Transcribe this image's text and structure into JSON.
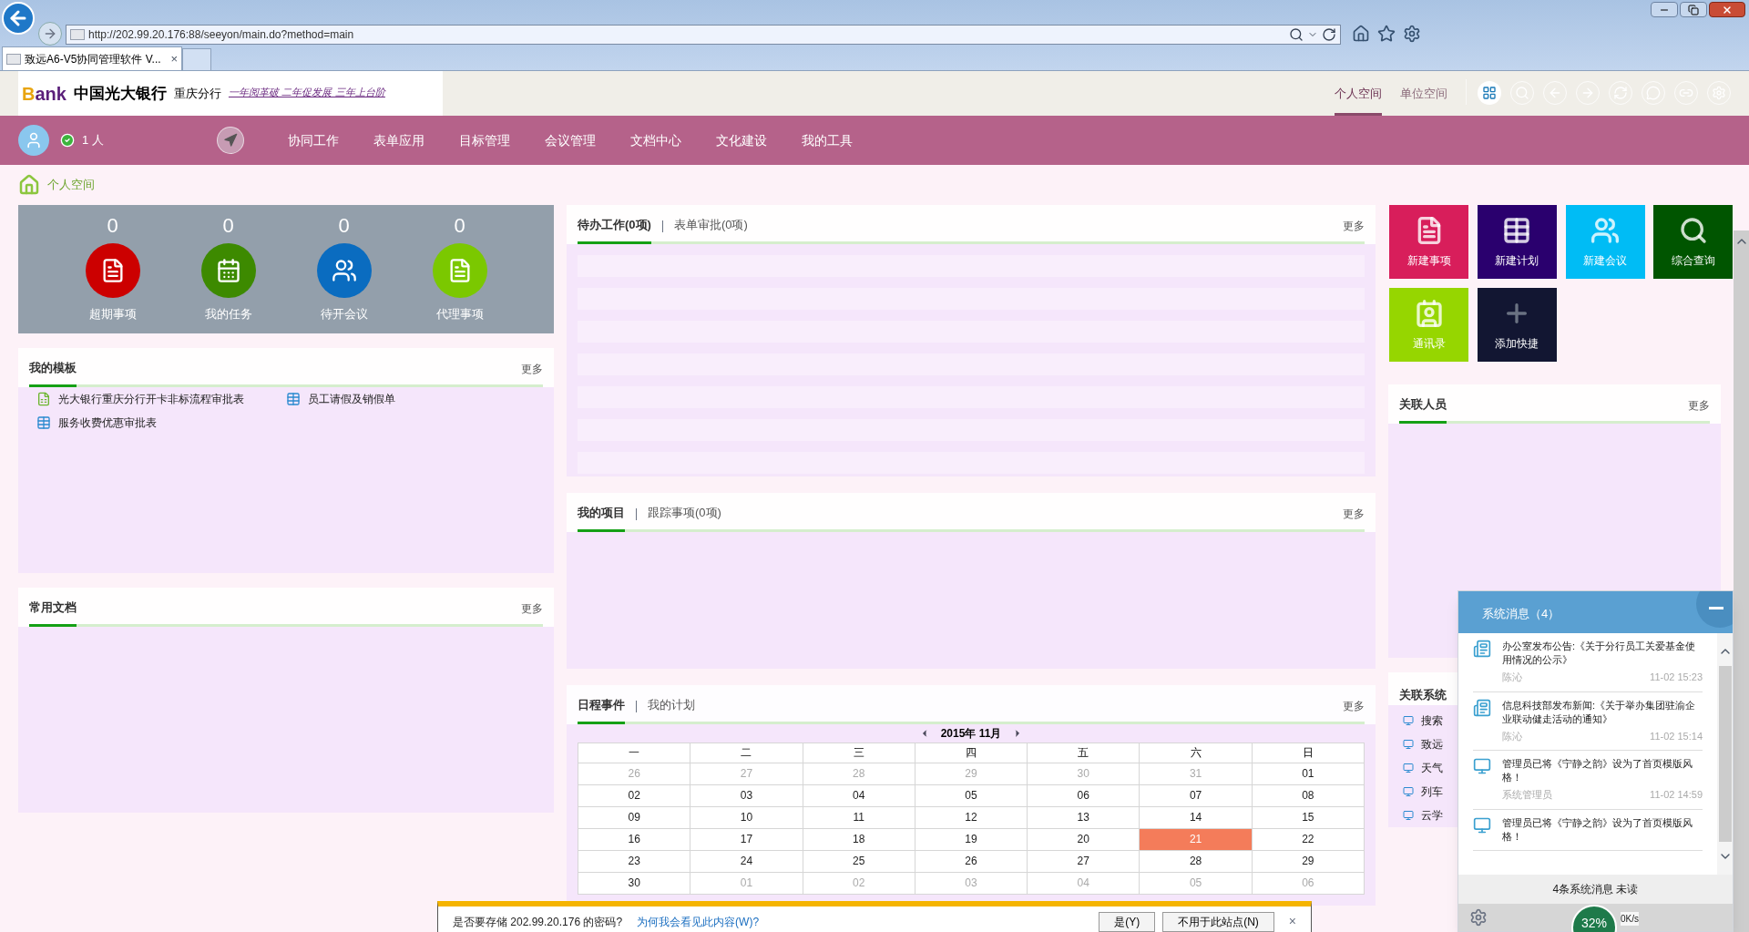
{
  "browser": {
    "address": "http://202.99.20.176:88/seeyon/main.do?method=main",
    "tab": "致远A6-V5协同管理软件 V...",
    "tab_close": "×"
  },
  "header": {
    "bank": "ank",
    "bank_initial": "B",
    "bank_name": "中国光大银行",
    "branch": "重庆分行",
    "slogan": "一年阅革破  二年促发展  三年上台阶",
    "spaces": [
      {
        "label": "个人空间",
        "selected": true
      },
      {
        "label": "单位空间",
        "selected": false
      }
    ]
  },
  "nav": {
    "online": "1 人",
    "items": [
      "协同工作",
      "表单应用",
      "目标管理",
      "会议管理",
      "文档中心",
      "文化建设",
      "我的工具"
    ]
  },
  "breadcrumb": "个人空间",
  "stats": [
    {
      "count": "0",
      "label": "超期事项",
      "color": "#cc0000",
      "kind": "doc"
    },
    {
      "count": "0",
      "label": "我的任务",
      "color": "#3d8a00",
      "kind": "task"
    },
    {
      "count": "0",
      "label": "待开会议",
      "color": "#0a6cc0",
      "kind": "meeting"
    },
    {
      "count": "0",
      "label": "代理事项",
      "color": "#7bc800",
      "kind": "agent"
    }
  ],
  "templates": {
    "title": "我的模板",
    "more": "更多",
    "items": [
      {
        "label": "光大银行重庆分行开卡非标流程审批表",
        "kind": "flow"
      },
      {
        "label": "员工请假及销假单",
        "kind": "form"
      },
      {
        "label": "服务收费优惠审批表",
        "kind": "form"
      }
    ]
  },
  "docs": {
    "title": "常用文档",
    "more": "更多"
  },
  "todo": {
    "tabs": [
      {
        "label": "待办工作(0项)",
        "selected": true
      },
      {
        "label": "表单审批(0项)",
        "selected": false
      }
    ],
    "more": "更多"
  },
  "projects": {
    "tabs": [
      {
        "label": "我的项目",
        "selected": true
      },
      {
        "label": "跟踪事项(0项)",
        "selected": false
      }
    ],
    "more": "更多"
  },
  "schedule": {
    "tabs": [
      {
        "label": "日程事件",
        "selected": true
      },
      {
        "label": "我的计划",
        "selected": false
      }
    ],
    "more": "更多",
    "month": "2015年 11月",
    "weekdays": [
      "一",
      "二",
      "三",
      "四",
      "五",
      "六",
      "日"
    ],
    "days": [
      {
        "day": "26",
        "muted": true,
        "selected": false
      },
      {
        "day": "27",
        "muted": true,
        "selected": false
      },
      {
        "day": "28",
        "muted": true,
        "selected": false
      },
      {
        "day": "29",
        "muted": true,
        "selected": false
      },
      {
        "day": "30",
        "muted": true,
        "selected": false
      },
      {
        "day": "31",
        "muted": true,
        "selected": false
      },
      {
        "day": "01",
        "muted": false,
        "selected": false
      },
      {
        "day": "02",
        "muted": false,
        "selected": false
      },
      {
        "day": "03",
        "muted": false,
        "selected": false
      },
      {
        "day": "04",
        "muted": false,
        "selected": false
      },
      {
        "day": "05",
        "muted": false,
        "selected": false
      },
      {
        "day": "06",
        "muted": false,
        "selected": false
      },
      {
        "day": "07",
        "muted": false,
        "selected": false
      },
      {
        "day": "08",
        "muted": false,
        "selected": false
      },
      {
        "day": "09",
        "muted": false,
        "selected": false
      },
      {
        "day": "10",
        "muted": false,
        "selected": false
      },
      {
        "day": "11",
        "muted": false,
        "selected": false
      },
      {
        "day": "12",
        "muted": false,
        "selected": false
      },
      {
        "day": "13",
        "muted": false,
        "selected": false
      },
      {
        "day": "14",
        "muted": false,
        "selected": false
      },
      {
        "day": "15",
        "muted": false,
        "selected": false
      },
      {
        "day": "16",
        "muted": false,
        "selected": false
      },
      {
        "day": "17",
        "muted": false,
        "selected": false
      },
      {
        "day": "18",
        "muted": false,
        "selected": false
      },
      {
        "day": "19",
        "muted": false,
        "selected": false
      },
      {
        "day": "20",
        "muted": false,
        "selected": false
      },
      {
        "day": "21",
        "muted": false,
        "selected": true
      },
      {
        "day": "22",
        "muted": false,
        "selected": false
      },
      {
        "day": "23",
        "muted": false,
        "selected": false
      },
      {
        "day": "24",
        "muted": false,
        "selected": false
      },
      {
        "day": "25",
        "muted": false,
        "selected": false
      },
      {
        "day": "26",
        "muted": false,
        "selected": false
      },
      {
        "day": "27",
        "muted": false,
        "selected": false
      },
      {
        "day": "28",
        "muted": false,
        "selected": false
      },
      {
        "day": "29",
        "muted": false,
        "selected": false
      },
      {
        "day": "30",
        "muted": false,
        "selected": false
      },
      {
        "day": "01",
        "muted": true,
        "selected": false
      },
      {
        "day": "02",
        "muted": true,
        "selected": false
      },
      {
        "day": "03",
        "muted": true,
        "selected": false
      },
      {
        "day": "04",
        "muted": true,
        "selected": false
      },
      {
        "day": "05",
        "muted": true,
        "selected": false
      },
      {
        "day": "06",
        "muted": true,
        "selected": false
      }
    ]
  },
  "shortcuts": [
    {
      "label": "新建事项",
      "color": "#d81e5b",
      "kind": "new-doc"
    },
    {
      "label": "新建计划",
      "color": "#2a006e",
      "kind": "new-plan"
    },
    {
      "label": "新建会议",
      "color": "#00bcf5",
      "kind": "new-meeting"
    },
    {
      "label": "综合查询",
      "color": "#005500",
      "kind": "search"
    },
    {
      "label": "通讯录",
      "color": "#96d600",
      "kind": "contacts"
    },
    {
      "label": "添加快捷",
      "color": "#121632",
      "kind": "add"
    }
  ],
  "people": {
    "title": "关联人员",
    "more": "更多"
  },
  "systems": {
    "title": "关联系统",
    "items": [
      "搜索",
      "致远",
      "天气",
      "列车",
      "云学"
    ]
  },
  "messages": {
    "title": "系统消息（4）",
    "items": [
      {
        "kind": "notice",
        "text": "办公室发布公告:《关于分行员工关爱基金使用情况的公示》",
        "sender": "陈沁",
        "time": "11-02 15:23"
      },
      {
        "kind": "notice",
        "text": "信息科技部发布新闻:《关于举办集团驻渝企业联动健走活动的通知》",
        "sender": "陈沁",
        "time": "11-02 15:14"
      },
      {
        "kind": "system",
        "text": "管理员已将《宁静之韵》设为了首页模版风格！",
        "sender": "系统管理员",
        "time": "11-02 14:59"
      },
      {
        "kind": "system",
        "text": "管理员已将《宁静之韵》设为了首页模版风格！"
      }
    ],
    "footer": "4条系统消息 未读"
  },
  "meter": {
    "percent": "32%",
    "speed": "0K/s"
  },
  "password_bar": {
    "text": "是否要存储 202.99.20.176 的密码?",
    "link": "为何我会看见此内容(W)?",
    "buttons": [
      "是(Y)",
      "不用于此站点(N)"
    ],
    "close": "×"
  }
}
